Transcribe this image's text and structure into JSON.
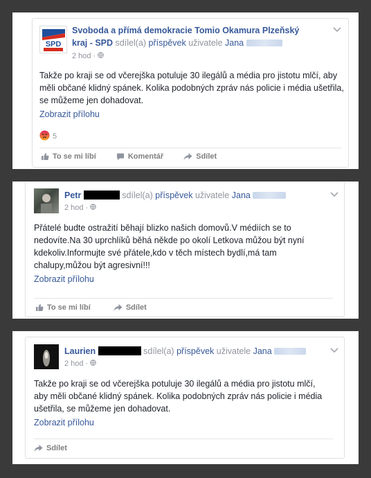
{
  "post1": {
    "page_name_line1": "Svoboda a přímá demokracie Tomio Okamura Plzeňský",
    "page_name_line2": "kraj - SPD",
    "shared_text": "sdílel(a)",
    "post_word": "příspěvek",
    "user_prefix": "uživatele",
    "user_name": "Jana",
    "time": "2 hod",
    "separator": "·",
    "body": "Takže po kraji se od včerejška potuluje 30 ilegálů a média pro jistotu mlčí, aby měli občané klidný spánek. Kolika podobných zpráv nás policie i média ušetřila, se můžeme jen dohadovat.",
    "attachment_link": "Zobrazit přílohu",
    "reaction_count": "5",
    "actions": {
      "like": "To se mi líbí",
      "comment": "Komentář",
      "share": "Sdílet"
    }
  },
  "post2": {
    "author_name": "Petr",
    "shared_text": "sdílel(a)",
    "post_word": "příspěvek",
    "user_prefix": "uživatele",
    "user_name": "Jana",
    "time": "2 hod",
    "separator": "·",
    "body": "Přátelé budte ostražití běhají blizko našich domovů.V médiích se to nedovíte.Na 30 uprchlíků běhá někde po okolí Letkova můžou být nyní kdekoliv.Informujte své přátele,kdo v těch místech bydlí,má tam chalupy,můžou být agresivní!!!",
    "attachment_link": "Zobrazit přílohu",
    "actions": {
      "like": "To se mi líbí",
      "share": "Sdílet"
    }
  },
  "post3": {
    "author_name": "Laurien",
    "shared_text": "sdílel(a)",
    "post_word": "příspěvek",
    "user_prefix": "uživatele",
    "user_name": "Jana",
    "time": "2 hod",
    "separator": "·",
    "body": "Takže po kraji se od včerejška potuluje 30 ilegálů a média pro jistotu mlčí, aby měli občané klidný spánek. Kolika podobných zpráv nás policie i média ušetřila, se můžeme jen dohadovat.",
    "attachment_link": "Zobrazit přílohu",
    "actions": {
      "share": "Sdílet"
    }
  },
  "icons": {
    "globe": "globe-icon",
    "chevron": "chevron-down-icon",
    "like": "thumbs-up-icon",
    "comment": "comment-icon",
    "share": "share-arrow-icon",
    "angry": "angry-reaction-icon"
  },
  "colors": {
    "link": "#365899",
    "text": "#1d2129",
    "meta": "#90949c",
    "spd_red": "#d62d20",
    "spd_blue": "#1f4e9c"
  }
}
